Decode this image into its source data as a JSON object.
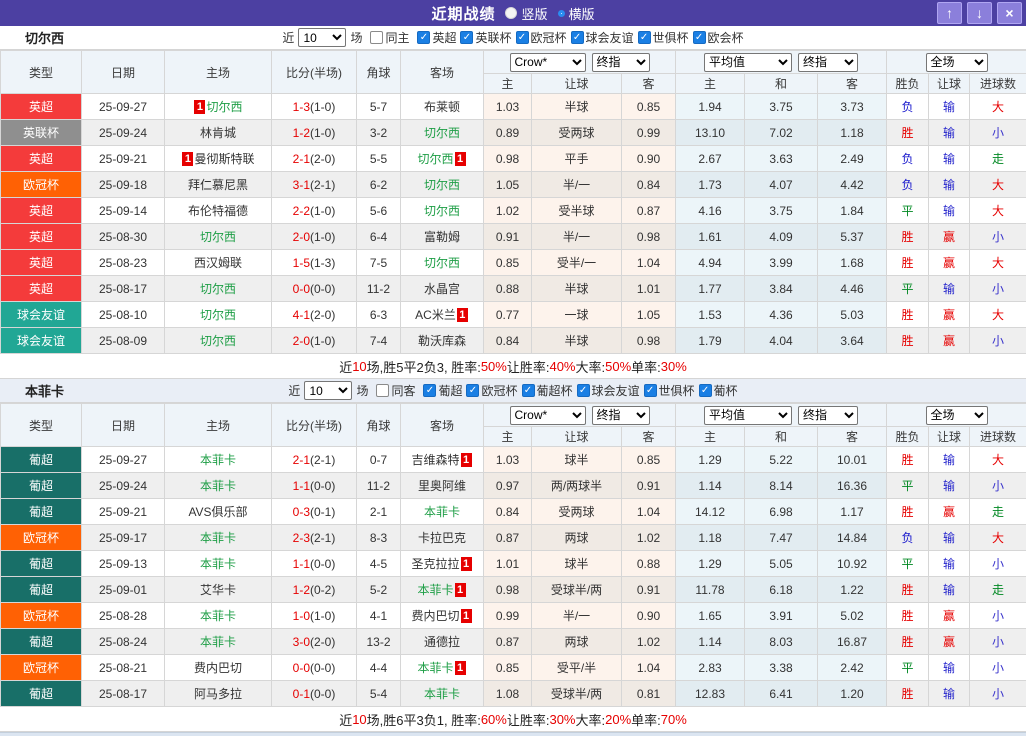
{
  "titlebar": {
    "title": "近期战绩",
    "vertical_label": "竖版",
    "horizontal_label": "横版",
    "up_icon": "↑",
    "down_icon": "↓",
    "close_icon": "×"
  },
  "icons": {
    "check": "✓"
  },
  "filter_labels": {
    "near": "近",
    "games": "场"
  },
  "table_header": {
    "cols": [
      "类型",
      "日期",
      "主场",
      "比分(半场)",
      "角球",
      "客场"
    ],
    "subs": [
      "主",
      "让球",
      "客",
      "主",
      "和",
      "客",
      "胜负",
      "让球",
      "进球数"
    ],
    "dropdowns": {
      "company": "Crow*",
      "company_time": "终指",
      "avg": "平均值",
      "avg_time": "终指",
      "scope": "全场"
    }
  },
  "colors": {
    "league": {
      "英超": "#f43b3b",
      "英联杯": "#8f8f8f",
      "欧冠杯": "#ff6104",
      "球会友谊": "#21a795",
      "葡超": "#186f68"
    },
    "result": {
      "胜": "#e60000",
      "平": "#008822",
      "负": "#1515cc",
      "赢": "#e60000",
      "输": "#2525cc",
      "走": "#008822",
      "大": "#e60000",
      "小": "#3b35cc"
    }
  },
  "sections": [
    {
      "team": "切尔西",
      "filter": {
        "count": "10",
        "same": "同主",
        "leagues": [
          "英超",
          "英联杯",
          "欧冠杯",
          "球会友谊",
          "世俱杯",
          "欧会杯"
        ]
      },
      "rows": [
        {
          "lg": "英超",
          "date": "25-09-27",
          "h": "切尔西",
          "hf": true,
          "hc": "1",
          "a": "布莱顿",
          "af": false,
          "ac": "",
          "ft": "1-3",
          "ht": "(1-0)",
          "cn": "5-7",
          "o1": "1.03",
          "o2": "半球",
          "o3": "0.85",
          "m1": "1.94",
          "m2": "3.75",
          "m3": "3.73",
          "r1": "负",
          "r2": "输",
          "r3": "大"
        },
        {
          "lg": "英联杯",
          "date": "25-09-24",
          "h": "林肯城",
          "hf": false,
          "hc": "",
          "a": "切尔西",
          "af": true,
          "ac": "",
          "ft": "1-2",
          "ht": "(1-0)",
          "cn": "3-2",
          "o1": "0.89",
          "o2": "受两球",
          "o3": "0.99",
          "m1": "13.10",
          "m2": "7.02",
          "m3": "1.18",
          "r1": "胜",
          "r2": "输",
          "r3": "小"
        },
        {
          "lg": "英超",
          "date": "25-09-21",
          "h": "曼彻斯特联",
          "hf": false,
          "hc": "1",
          "a": "切尔西",
          "af": true,
          "ac": "1",
          "ft": "2-1",
          "ht": "(2-0)",
          "cn": "5-5",
          "o1": "0.98",
          "o2": "平手",
          "o3": "0.90",
          "m1": "2.67",
          "m2": "3.63",
          "m3": "2.49",
          "r1": "负",
          "r2": "输",
          "r3": "走"
        },
        {
          "lg": "欧冠杯",
          "date": "25-09-18",
          "h": "拜仁慕尼黑",
          "hf": false,
          "hc": "",
          "a": "切尔西",
          "af": true,
          "ac": "",
          "ft": "3-1",
          "ht": "(2-1)",
          "cn": "6-2",
          "o1": "1.05",
          "o2": "半/一",
          "o3": "0.84",
          "m1": "1.73",
          "m2": "4.07",
          "m3": "4.42",
          "r1": "负",
          "r2": "输",
          "r3": "大"
        },
        {
          "lg": "英超",
          "date": "25-09-14",
          "h": "布伦特福德",
          "hf": false,
          "hc": "",
          "a": "切尔西",
          "af": true,
          "ac": "",
          "ft": "2-2",
          "ht": "(1-0)",
          "cn": "5-6",
          "o1": "1.02",
          "o2": "受半球",
          "o3": "0.87",
          "m1": "4.16",
          "m2": "3.75",
          "m3": "1.84",
          "r1": "平",
          "r2": "输",
          "r3": "大"
        },
        {
          "lg": "英超",
          "date": "25-08-30",
          "h": "切尔西",
          "hf": true,
          "hc": "",
          "a": "富勒姆",
          "af": false,
          "ac": "",
          "ft": "2-0",
          "ht": "(1-0)",
          "cn": "6-4",
          "o1": "0.91",
          "o2": "半/一",
          "o3": "0.98",
          "m1": "1.61",
          "m2": "4.09",
          "m3": "5.37",
          "r1": "胜",
          "r2": "赢",
          "r3": "小"
        },
        {
          "lg": "英超",
          "date": "25-08-23",
          "h": "西汉姆联",
          "hf": false,
          "hc": "",
          "a": "切尔西",
          "af": true,
          "ac": "",
          "ft": "1-5",
          "ht": "(1-3)",
          "cn": "7-5",
          "o1": "0.85",
          "o2": "受半/一",
          "o3": "1.04",
          "m1": "4.94",
          "m2": "3.99",
          "m3": "1.68",
          "r1": "胜",
          "r2": "赢",
          "r3": "大"
        },
        {
          "lg": "英超",
          "date": "25-08-17",
          "h": "切尔西",
          "hf": true,
          "hc": "",
          "a": "水晶宫",
          "af": false,
          "ac": "",
          "ft": "0-0",
          "ht": "(0-0)",
          "cn": "11-2",
          "o1": "0.88",
          "o2": "半球",
          "o3": "1.01",
          "m1": "1.77",
          "m2": "3.84",
          "m3": "4.46",
          "r1": "平",
          "r2": "输",
          "r3": "小"
        },
        {
          "lg": "球会友谊",
          "date": "25-08-10",
          "h": "切尔西",
          "hf": true,
          "hc": "",
          "a": "AC米兰",
          "af": false,
          "ac": "1",
          "ft": "4-1",
          "ht": "(2-0)",
          "cn": "6-3",
          "o1": "0.77",
          "o2": "一球",
          "o3": "1.05",
          "m1": "1.53",
          "m2": "4.36",
          "m3": "5.03",
          "r1": "胜",
          "r2": "赢",
          "r3": "大"
        },
        {
          "lg": "球会友谊",
          "date": "25-08-09",
          "h": "切尔西",
          "hf": true,
          "hc": "",
          "a": "勒沃库森",
          "af": false,
          "ac": "",
          "ft": "2-0",
          "ht": "(1-0)",
          "cn": "7-4",
          "o1": "0.84",
          "o2": "半球",
          "o3": "0.98",
          "m1": "1.79",
          "m2": "4.04",
          "m3": "3.64",
          "r1": "胜",
          "r2": "赢",
          "r3": "小"
        }
      ],
      "summary": [
        {
          "t": "近",
          "red": false
        },
        {
          "t": "10",
          "red": true
        },
        {
          "t": "场,胜5平2负3, 胜率:",
          "red": false
        },
        {
          "t": "50%",
          "red": true
        },
        {
          "t": " 让胜率:",
          "red": false
        },
        {
          "t": "40%",
          "red": true
        },
        {
          "t": " 大率:",
          "red": false
        },
        {
          "t": "50%",
          "red": true
        },
        {
          "t": " 单率:",
          "red": false
        },
        {
          "t": "30%",
          "red": true
        }
      ]
    },
    {
      "team": "本菲卡",
      "filter": {
        "count": "10",
        "same": "同客",
        "leagues": [
          "葡超",
          "欧冠杯",
          "葡超杯",
          "球会友谊",
          "世俱杯",
          "葡杯"
        ]
      },
      "rows": [
        {
          "lg": "葡超",
          "date": "25-09-27",
          "h": "本菲卡",
          "hf": true,
          "hc": "",
          "a": "吉维森特",
          "af": false,
          "ac": "1",
          "ft": "2-1",
          "ht": "(2-1)",
          "cn": "0-7",
          "o1": "1.03",
          "o2": "球半",
          "o3": "0.85",
          "m1": "1.29",
          "m2": "5.22",
          "m3": "10.01",
          "r1": "胜",
          "r2": "输",
          "r3": "大"
        },
        {
          "lg": "葡超",
          "date": "25-09-24",
          "h": "本菲卡",
          "hf": true,
          "hc": "",
          "a": "里奥阿维",
          "af": false,
          "ac": "",
          "ft": "1-1",
          "ht": "(0-0)",
          "cn": "11-2",
          "o1": "0.97",
          "o2": "两/两球半",
          "o3": "0.91",
          "m1": "1.14",
          "m2": "8.14",
          "m3": "16.36",
          "r1": "平",
          "r2": "输",
          "r3": "小"
        },
        {
          "lg": "葡超",
          "date": "25-09-21",
          "h": "AVS俱乐部",
          "hf": false,
          "hc": "",
          "a": "本菲卡",
          "af": true,
          "ac": "",
          "ft": "0-3",
          "ht": "(0-1)",
          "cn": "2-1",
          "o1": "0.84",
          "o2": "受两球",
          "o3": "1.04",
          "m1": "14.12",
          "m2": "6.98",
          "m3": "1.17",
          "r1": "胜",
          "r2": "赢",
          "r3": "走"
        },
        {
          "lg": "欧冠杯",
          "date": "25-09-17",
          "h": "本菲卡",
          "hf": true,
          "hc": "",
          "a": "卡拉巴克",
          "af": false,
          "ac": "",
          "ft": "2-3",
          "ht": "(2-1)",
          "cn": "8-3",
          "o1": "0.87",
          "o2": "两球",
          "o3": "1.02",
          "m1": "1.18",
          "m2": "7.47",
          "m3": "14.84",
          "r1": "负",
          "r2": "输",
          "r3": "大"
        },
        {
          "lg": "葡超",
          "date": "25-09-13",
          "h": "本菲卡",
          "hf": true,
          "hc": "",
          "a": "圣克拉拉",
          "af": false,
          "ac": "1",
          "ft": "1-1",
          "ht": "(0-0)",
          "cn": "4-5",
          "o1": "1.01",
          "o2": "球半",
          "o3": "0.88",
          "m1": "1.29",
          "m2": "5.05",
          "m3": "10.92",
          "r1": "平",
          "r2": "输",
          "r3": "小"
        },
        {
          "lg": "葡超",
          "date": "25-09-01",
          "h": "艾华卡",
          "hf": false,
          "hc": "",
          "a": "本菲卡",
          "af": true,
          "ac": "1",
          "ft": "1-2",
          "ht": "(0-2)",
          "cn": "5-2",
          "o1": "0.98",
          "o2": "受球半/两",
          "o3": "0.91",
          "m1": "11.78",
          "m2": "6.18",
          "m3": "1.22",
          "r1": "胜",
          "r2": "输",
          "r3": "走"
        },
        {
          "lg": "欧冠杯",
          "date": "25-08-28",
          "h": "本菲卡",
          "hf": true,
          "hc": "",
          "a": "费内巴切",
          "af": false,
          "ac": "1",
          "ft": "1-0",
          "ht": "(1-0)",
          "cn": "4-1",
          "o1": "0.99",
          "o2": "半/一",
          "o3": "0.90",
          "m1": "1.65",
          "m2": "3.91",
          "m3": "5.02",
          "r1": "胜",
          "r2": "赢",
          "r3": "小"
        },
        {
          "lg": "葡超",
          "date": "25-08-24",
          "h": "本菲卡",
          "hf": true,
          "hc": "",
          "a": "通德拉",
          "af": false,
          "ac": "",
          "ft": "3-0",
          "ht": "(2-0)",
          "cn": "13-2",
          "o1": "0.87",
          "o2": "两球",
          "o3": "1.02",
          "m1": "1.14",
          "m2": "8.03",
          "m3": "16.87",
          "r1": "胜",
          "r2": "赢",
          "r3": "小"
        },
        {
          "lg": "欧冠杯",
          "date": "25-08-21",
          "h": "费内巴切",
          "hf": false,
          "hc": "",
          "a": "本菲卡",
          "af": true,
          "ac": "1",
          "ft": "0-0",
          "ht": "(0-0)",
          "cn": "4-4",
          "o1": "0.85",
          "o2": "受平/半",
          "o3": "1.04",
          "m1": "2.83",
          "m2": "3.38",
          "m3": "2.42",
          "r1": "平",
          "r2": "输",
          "r3": "小"
        },
        {
          "lg": "葡超",
          "date": "25-08-17",
          "h": "阿马多拉",
          "hf": false,
          "hc": "",
          "a": "本菲卡",
          "af": true,
          "ac": "",
          "ft": "0-1",
          "ht": "(0-0)",
          "cn": "5-4",
          "o1": "1.08",
          "o2": "受球半/两",
          "o3": "0.81",
          "m1": "12.83",
          "m2": "6.41",
          "m3": "1.20",
          "r1": "胜",
          "r2": "输",
          "r3": "小"
        }
      ],
      "summary": [
        {
          "t": "近",
          "red": false
        },
        {
          "t": "10",
          "red": true
        },
        {
          "t": "场,胜6平3负1, 胜率:",
          "red": false
        },
        {
          "t": "60%",
          "red": true
        },
        {
          "t": " 让胜率:",
          "red": false
        },
        {
          "t": "30%",
          "red": true
        },
        {
          "t": " 大率:",
          "red": false
        },
        {
          "t": "20%",
          "red": true
        },
        {
          "t": " 单率:",
          "red": false
        },
        {
          "t": "70%",
          "red": true
        }
      ]
    }
  ]
}
